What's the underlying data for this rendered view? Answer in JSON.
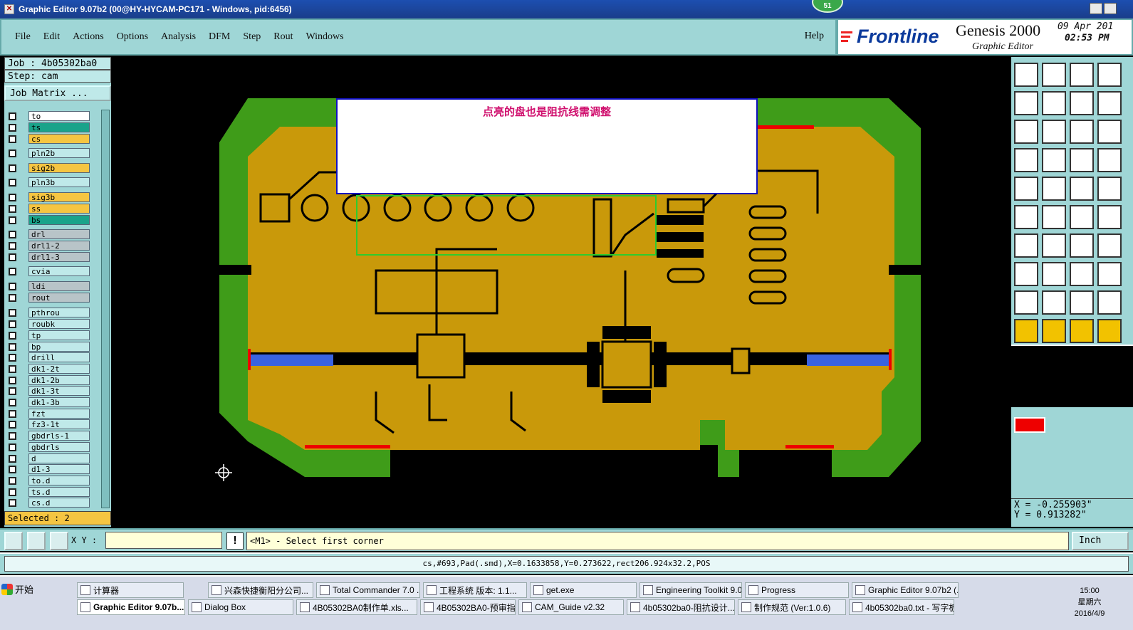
{
  "window": {
    "title": "Graphic Editor 9.07b2 (00@HY-HYCAM-PC171 - Windows, pid:6456)",
    "notification_badge": "51"
  },
  "menu": {
    "items": [
      "File",
      "Edit",
      "Actions",
      "Options",
      "Analysis",
      "DFM",
      "Step",
      "Rout",
      "Windows"
    ],
    "help": "Help"
  },
  "brand": {
    "logo": "Frontline",
    "product": "Genesis 2000",
    "subtitle": "Graphic Editor",
    "date": "09 Apr 201",
    "time": "02:53 PM"
  },
  "job": {
    "job_line": "Job : 4b05302ba0",
    "step_line": "Step: cam",
    "matrix_button": "Job Matrix ...",
    "selected": "Selected : 2"
  },
  "layers": [
    {
      "name": "to",
      "color": "#ffffff"
    },
    {
      "name": "ts",
      "color": "#1aa38a"
    },
    {
      "name": "cs",
      "color": "#f5c542"
    },
    {
      "name": "pln2b",
      "color": "#bfe9e9"
    },
    {
      "name": "sig2b",
      "color": "#f5c542"
    },
    {
      "name": "pln3b",
      "color": "#bfe9e9"
    },
    {
      "name": "sig3b",
      "color": "#f5c542"
    },
    {
      "name": "ss",
      "color": "#f5c542"
    },
    {
      "name": "bs",
      "color": "#1aa38a"
    },
    {
      "name": "drl",
      "color": "#b8c4c8"
    },
    {
      "name": "drl1-2",
      "color": "#b8c4c8"
    },
    {
      "name": "drl1-3",
      "color": "#b8c4c8"
    },
    {
      "name": "cvia",
      "color": "#bfe9e9"
    },
    {
      "name": "ldi",
      "color": "#b8c4c8"
    },
    {
      "name": "rout",
      "color": "#b8c4c8"
    },
    {
      "name": "pthrou",
      "color": "#bfe9e9"
    },
    {
      "name": "roubk",
      "color": "#bfe9e9"
    },
    {
      "name": "tp",
      "color": "#bfe9e9"
    },
    {
      "name": "bp",
      "color": "#bfe9e9"
    },
    {
      "name": "drill",
      "color": "#bfe9e9"
    },
    {
      "name": "dk1-2t",
      "color": "#bfe9e9"
    },
    {
      "name": "dk1-2b",
      "color": "#bfe9e9"
    },
    {
      "name": "dk1-3t",
      "color": "#bfe9e9"
    },
    {
      "name": "dk1-3b",
      "color": "#bfe9e9"
    },
    {
      "name": "fzt",
      "color": "#bfe9e9"
    },
    {
      "name": "fz3-1t",
      "color": "#bfe9e9"
    },
    {
      "name": "gbdrls-1",
      "color": "#bfe9e9"
    },
    {
      "name": "gbdrls",
      "color": "#bfe9e9"
    },
    {
      "name": "d",
      "color": "#bfe9e9"
    },
    {
      "name": "d1-3",
      "color": "#bfe9e9"
    },
    {
      "name": "to.d",
      "color": "#bfe9e9"
    },
    {
      "name": "ts.d",
      "color": "#bfe9e9"
    },
    {
      "name": "cs.d",
      "color": "#bfe9e9"
    }
  ],
  "canvas": {
    "annotation": "点亮的盘也是阻抗线需调整"
  },
  "coords": {
    "x": "X = -0.255903\"",
    "y": "Y = 0.913282\""
  },
  "command": {
    "xy_label": "X Y :",
    "xy_value": "",
    "prompt_icon": "!",
    "prompt": "<M1> - Select first corner",
    "unit": "Inch"
  },
  "status": {
    "line": "cs,#693,Pad(.smd),X=0.1633858,Y=0.273622,rect206.924x32.2,POS"
  },
  "taskbar": {
    "start": "开始",
    "row1": [
      "计算器",
      "兴森快捷衡阳分公司...",
      "Total Commander 7.0 ...",
      "工程系统  版本: 1.1...",
      "get.exe",
      "Engineering Toolkit 9.0...",
      "Progress",
      "Graphic Editor 9.07b2 (..."
    ],
    "row2": [
      "Graphic Editor 9.07b...",
      "Dialog Box",
      "4B05302BA0制作单.xls...",
      "4B05302BA0-预审指示...",
      "CAM_Guide v2.32",
      "4b05302ba0-阻抗设计...",
      "制作规范 (Ver:1.0.6)",
      "4b05302ba0.txt - 写字板"
    ],
    "clock_time": "15:00",
    "clock_day": "星期六",
    "clock_date": "2016/4/9"
  }
}
